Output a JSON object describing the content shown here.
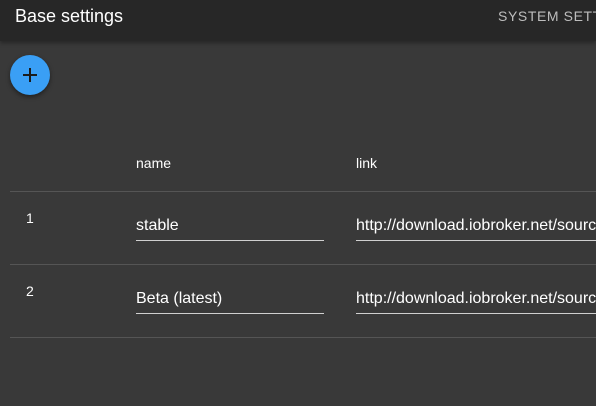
{
  "header": {
    "title": "Base settings",
    "tab_label": "SYSTEM SETT"
  },
  "toolbar": {
    "add_icon": "plus-icon",
    "accent_color": "#3a9ff5"
  },
  "table": {
    "columns": [
      "name",
      "link"
    ],
    "rows": [
      {
        "index": "1",
        "name": "stable",
        "link": "http://download.iobroker.net/sourc"
      },
      {
        "index": "2",
        "name": "Beta (latest)",
        "link": "http://download.iobroker.net/sourc"
      }
    ]
  }
}
